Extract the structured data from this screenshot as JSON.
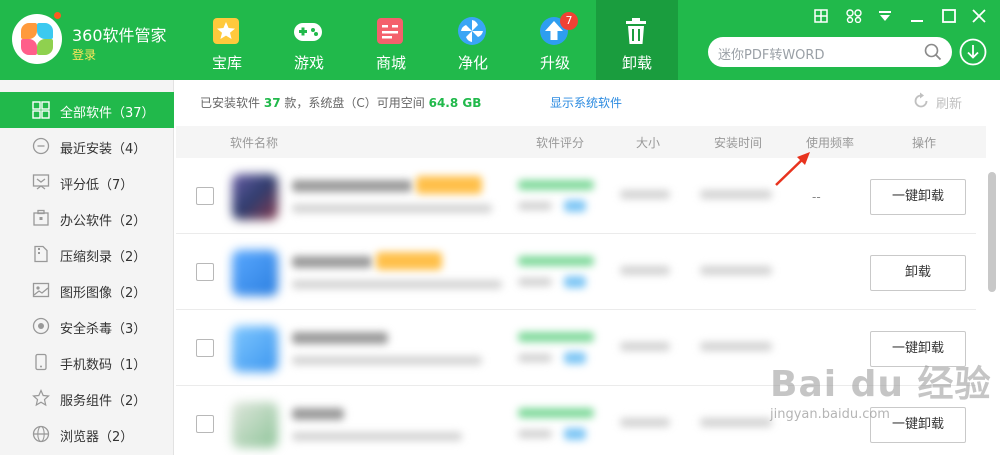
{
  "app": {
    "title": "360软件管家",
    "login": "登录"
  },
  "nav": [
    {
      "label": "宝库",
      "icon": "treasure-star-icon"
    },
    {
      "label": "游戏",
      "icon": "gamepad-icon"
    },
    {
      "label": "商城",
      "icon": "store-icon"
    },
    {
      "label": "净化",
      "icon": "purify-fan-icon"
    },
    {
      "label": "升级",
      "icon": "upgrade-arrow-icon",
      "badge": "7"
    },
    {
      "label": "卸载",
      "icon": "trash-icon",
      "active": true
    }
  ],
  "window_controls": [
    "grid-icon",
    "skin-icon",
    "menu-down-icon",
    "minimize-icon",
    "maximize-icon",
    "close-icon"
  ],
  "search": {
    "value": "迷你PDF转WORD",
    "icon": "search-icon"
  },
  "sidebar": {
    "items": [
      {
        "label": "全部软件（37）",
        "icon": "all-apps-icon",
        "active": true
      },
      {
        "label": "最近安装（4）",
        "icon": "recent-icon"
      },
      {
        "label": "评分低（7）",
        "icon": "low-rating-icon"
      },
      {
        "label": "办公软件（2）",
        "icon": "office-icon"
      },
      {
        "label": "压缩刻录（2）",
        "icon": "compress-icon"
      },
      {
        "label": "图形图像（2）",
        "icon": "image-icon"
      },
      {
        "label": "安全杀毒（3）",
        "icon": "security-icon"
      },
      {
        "label": "手机数码（1）",
        "icon": "phone-icon"
      },
      {
        "label": "服务组件（2）",
        "icon": "service-icon"
      },
      {
        "label": "浏览器（2）",
        "icon": "browser-icon"
      }
    ]
  },
  "info": {
    "prefix": "已安装软件",
    "count": "37",
    "middle": "款，系统盘（C）可用空间",
    "free_space": "64.8 GB",
    "show_system": "显示系统软件",
    "refresh": "刷新"
  },
  "table": {
    "headers": [
      "软件名称",
      "软件评分",
      "大小",
      "安装时间",
      "使用频率",
      "操作"
    ],
    "rows": [
      {
        "usage": "--",
        "action": "一键卸载"
      },
      {
        "usage": "",
        "action": "卸载"
      },
      {
        "usage": "",
        "action": "一键卸载"
      },
      {
        "usage": "",
        "action": "一键卸载"
      }
    ]
  },
  "watermark": {
    "main": "Bai du 经验",
    "sub": "jingyan.baidu.com"
  },
  "colors": {
    "brand_green": "#21b94b",
    "active_green": "#1a9d3e",
    "link_blue": "#2c8be0",
    "badge_red": "#f04134",
    "arrow_red": "#e8331e"
  }
}
